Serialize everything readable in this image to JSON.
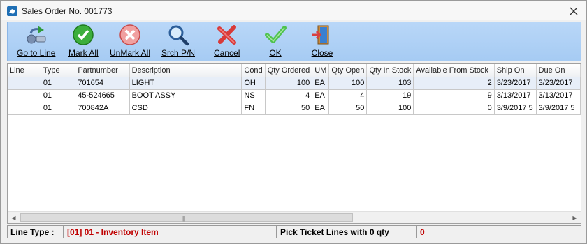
{
  "window": {
    "title": "Sales Order No. 001773"
  },
  "toolbar": {
    "buttons": [
      {
        "label": "Go to Line",
        "icon": "go-to-line-icon"
      },
      {
        "label": "Mark All",
        "icon": "green-check-icon"
      },
      {
        "label": "UnMark All",
        "icon": "red-x-circle-icon"
      },
      {
        "label": "Srch P/N",
        "icon": "magnifier-icon"
      },
      {
        "label": "Cancel",
        "icon": "red-x-icon"
      },
      {
        "label": "OK",
        "icon": "checkmark-icon"
      },
      {
        "label": "Close",
        "icon": "exit-door-icon"
      }
    ]
  },
  "grid": {
    "columns": [
      "Line",
      "Type",
      "Partnumber",
      "Description",
      "Cond",
      "Qty Ordered",
      "UM",
      "Qty Open",
      "Qty In Stock",
      "Available From Stock",
      "Ship On",
      "Due On"
    ],
    "rows": [
      [
        "",
        "01",
        "701654",
        "LIGHT",
        "OH",
        "100",
        "EA",
        "100",
        "103",
        "2",
        "3/23/2017",
        "3/23/2017"
      ],
      [
        "",
        "01",
        "45-524665",
        "BOOT ASSY",
        "NS",
        "4",
        "EA",
        "4",
        "19",
        "9",
        "3/13/2017",
        "3/13/2017"
      ],
      [
        "",
        "01",
        "700842A",
        "CSD",
        "FN",
        "50",
        "EA",
        "50",
        "100",
        "0",
        "3/9/2017 5",
        "3/9/2017 5"
      ]
    ]
  },
  "status": {
    "line_type_label": "Line Type :",
    "line_type_value": "[01] 01 - Inventory Item",
    "pick_ticket_label": "Pick Ticket Lines with 0 qty",
    "pick_ticket_value": "0"
  },
  "colors": {
    "toolbar_bg": "#a6cbf3",
    "status_red": "#c00000"
  }
}
